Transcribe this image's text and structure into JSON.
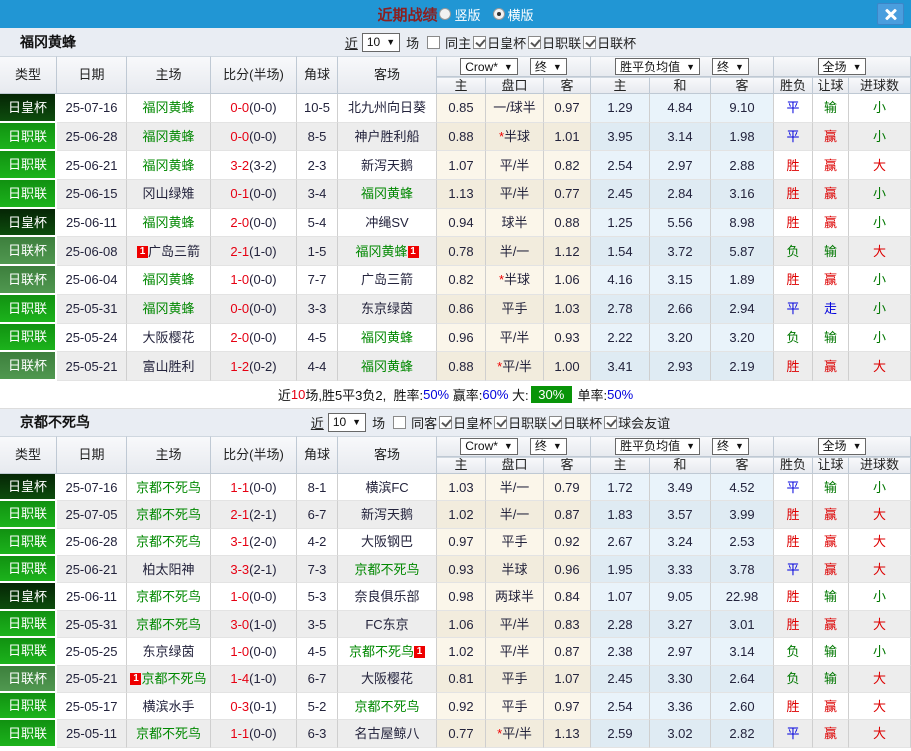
{
  "colors": {
    "topbar_bg": "#2196d4",
    "title_color": "#8b1f1f",
    "team_green": "#008800",
    "score_red": "#e60012",
    "res_red": "#dd0000",
    "res_blue": "#0000dd",
    "res_green": "#007700"
  },
  "topbar": {
    "title": "近期战绩",
    "radios": [
      {
        "label": "竖版",
        "checked": false
      },
      {
        "label": "横版",
        "checked": true
      }
    ]
  },
  "table_header": {
    "left_cols": [
      "类型",
      "日期",
      "主场",
      "比分(半场)",
      "角球",
      "客场"
    ],
    "groups": [
      {
        "selects": [
          "Crow*",
          "终"
        ],
        "cols": [
          "主",
          "盘口",
          "客"
        ]
      },
      {
        "selects": [
          "胜平负均值",
          "终"
        ],
        "cols": [
          "主",
          "和",
          "客"
        ]
      },
      {
        "selects": [
          "全场"
        ],
        "cols": [
          "胜负",
          "让球",
          "进球数"
        ]
      }
    ]
  },
  "sections": [
    {
      "team": "福冈黄蜂",
      "filter": {
        "near": "近",
        "count": "10",
        "games": "场",
        "same": {
          "label": "同主",
          "checked": false
        },
        "leagues": [
          {
            "label": "日皇杯",
            "checked": true
          },
          {
            "label": "日职联",
            "checked": true
          },
          {
            "label": "日联杯",
            "checked": true
          }
        ]
      },
      "rows": [
        {
          "type": "日皇杯",
          "style": "cup",
          "date": "25-07-16",
          "home": {
            "name": "福冈黄蜂",
            "green": true
          },
          "ft": "0-0",
          "ht": "(0-0)",
          "corner": "10-5",
          "away": {
            "name": "北九州向日葵"
          },
          "o1": "0.85",
          "pan": "一/球半",
          "pan_star": false,
          "o2": "0.97",
          "a1": "1.29",
          "a2": "4.84",
          "a3": "9.10",
          "res": "平",
          "res_c": "blue",
          "let": "输",
          "let_c": "green",
          "size": "小",
          "size_c": "green"
        },
        {
          "type": "日职联",
          "style": "jl",
          "date": "25-06-28",
          "home": {
            "name": "福冈黄蜂",
            "green": true
          },
          "ft": "0-0",
          "ht": "(0-0)",
          "corner": "8-5",
          "away": {
            "name": "神户胜利船"
          },
          "o1": "0.88",
          "pan": "半球",
          "pan_star": true,
          "o2": "1.01",
          "a1": "3.95",
          "a2": "3.14",
          "a3": "1.98",
          "res": "平",
          "res_c": "blue",
          "let": "赢",
          "let_c": "red",
          "size": "小",
          "size_c": "green"
        },
        {
          "type": "日职联",
          "style": "jl",
          "date": "25-06-21",
          "home": {
            "name": "福冈黄蜂",
            "green": true
          },
          "ft": "3-2",
          "ht": "(3-2)",
          "corner": "2-3",
          "away": {
            "name": "新泻天鹅"
          },
          "o1": "1.07",
          "pan": "平/半",
          "pan_star": false,
          "o2": "0.82",
          "a1": "2.54",
          "a2": "2.97",
          "a3": "2.88",
          "res": "胜",
          "res_c": "red",
          "let": "赢",
          "let_c": "red",
          "size": "大",
          "size_c": "red"
        },
        {
          "type": "日职联",
          "style": "jl",
          "date": "25-06-15",
          "home": {
            "name": "冈山绿雉"
          },
          "ft": "0-1",
          "ht": "(0-0)",
          "corner": "3-4",
          "away": {
            "name": "福冈黄蜂",
            "green": true
          },
          "o1": "1.13",
          "pan": "平/半",
          "pan_star": false,
          "o2": "0.77",
          "a1": "2.45",
          "a2": "2.84",
          "a3": "3.16",
          "res": "胜",
          "res_c": "red",
          "let": "赢",
          "let_c": "red",
          "size": "小",
          "size_c": "green"
        },
        {
          "type": "日皇杯",
          "style": "cup",
          "date": "25-06-11",
          "home": {
            "name": "福冈黄蜂",
            "green": true
          },
          "ft": "2-0",
          "ht": "(0-0)",
          "corner": "5-4",
          "away": {
            "name": "冲绳SV"
          },
          "o1": "0.94",
          "pan": "球半",
          "pan_star": false,
          "o2": "0.88",
          "a1": "1.25",
          "a2": "5.56",
          "a3": "8.98",
          "res": "胜",
          "res_c": "red",
          "let": "赢",
          "let_c": "red",
          "size": "小",
          "size_c": "green"
        },
        {
          "type": "日联杯",
          "style": "lc",
          "date": "25-06-08",
          "home": {
            "name": "广岛三箭",
            "badge_before": "1"
          },
          "ft": "2-1",
          "ht": "(1-0)",
          "corner": "1-5",
          "away": {
            "name": "福冈黄蜂",
            "green": true,
            "badge_after": "1"
          },
          "o1": "0.78",
          "pan": "半/一",
          "pan_star": false,
          "o2": "1.12",
          "a1": "1.54",
          "a2": "3.72",
          "a3": "5.87",
          "res": "负",
          "res_c": "green",
          "let": "输",
          "let_c": "green",
          "size": "大",
          "size_c": "red"
        },
        {
          "type": "日联杯",
          "style": "lc",
          "date": "25-06-04",
          "home": {
            "name": "福冈黄蜂",
            "green": true
          },
          "ft": "1-0",
          "ht": "(0-0)",
          "corner": "7-7",
          "away": {
            "name": "广岛三箭"
          },
          "o1": "0.82",
          "pan": "半球",
          "pan_star": true,
          "o2": "1.06",
          "a1": "4.16",
          "a2": "3.15",
          "a3": "1.89",
          "res": "胜",
          "res_c": "red",
          "let": "赢",
          "let_c": "red",
          "size": "小",
          "size_c": "green"
        },
        {
          "type": "日职联",
          "style": "jl",
          "date": "25-05-31",
          "home": {
            "name": "福冈黄蜂",
            "green": true
          },
          "ft": "0-0",
          "ht": "(0-0)",
          "corner": "3-3",
          "away": {
            "name": "东京绿茵"
          },
          "o1": "0.86",
          "pan": "平手",
          "pan_star": false,
          "o2": "1.03",
          "a1": "2.78",
          "a2": "2.66",
          "a3": "2.94",
          "res": "平",
          "res_c": "blue",
          "let": "走",
          "let_c": "blue",
          "size": "小",
          "size_c": "green"
        },
        {
          "type": "日职联",
          "style": "jl",
          "date": "25-05-24",
          "home": {
            "name": "大阪樱花"
          },
          "ft": "2-0",
          "ht": "(0-0)",
          "corner": "4-5",
          "away": {
            "name": "福冈黄蜂",
            "green": true
          },
          "o1": "0.96",
          "pan": "平/半",
          "pan_star": false,
          "o2": "0.93",
          "a1": "2.22",
          "a2": "3.20",
          "a3": "3.20",
          "res": "负",
          "res_c": "green",
          "let": "输",
          "let_c": "green",
          "size": "小",
          "size_c": "green"
        },
        {
          "type": "日联杯",
          "style": "lc",
          "date": "25-05-21",
          "home": {
            "name": "富山胜利"
          },
          "ft": "1-2",
          "ht": "(0-2)",
          "corner": "4-4",
          "away": {
            "name": "福冈黄蜂",
            "green": true
          },
          "o1": "0.88",
          "pan": "平/半",
          "pan_star": true,
          "o2": "1.00",
          "a1": "3.41",
          "a2": "2.93",
          "a3": "2.19",
          "res": "胜",
          "res_c": "red",
          "let": "赢",
          "let_c": "red",
          "size": "大",
          "size_c": "red"
        }
      ],
      "summary": {
        "prefix": "近",
        "count": "10",
        "mid": "场,胜5平3负2, ",
        "stats": [
          {
            "label": "胜率:",
            "value": "50%",
            "style": "blue"
          },
          {
            "label": "赢率:",
            "value": "60%",
            "style": "blue"
          },
          {
            "label": "大:",
            "value": "30%",
            "style": "badge"
          },
          {
            "label": "单率:",
            "value": "50%",
            "style": "blue"
          }
        ]
      }
    },
    {
      "team": "京都不死鸟",
      "filter": {
        "near": "近",
        "count": "10",
        "games": "场",
        "same": {
          "label": "同客",
          "checked": false
        },
        "leagues": [
          {
            "label": "日皇杯",
            "checked": true
          },
          {
            "label": "日职联",
            "checked": true
          },
          {
            "label": "日联杯",
            "checked": true
          },
          {
            "label": "球会友谊",
            "checked": true
          }
        ]
      },
      "rows": [
        {
          "type": "日皇杯",
          "style": "cup",
          "date": "25-07-16",
          "home": {
            "name": "京都不死鸟",
            "green": true
          },
          "ft": "1-1",
          "ht": "(0-0)",
          "corner": "8-1",
          "away": {
            "name": "横滨FC"
          },
          "o1": "1.03",
          "pan": "半/一",
          "pan_star": false,
          "o2": "0.79",
          "a1": "1.72",
          "a2": "3.49",
          "a3": "4.52",
          "res": "平",
          "res_c": "blue",
          "let": "输",
          "let_c": "green",
          "size": "小",
          "size_c": "green"
        },
        {
          "type": "日职联",
          "style": "jl",
          "date": "25-07-05",
          "home": {
            "name": "京都不死鸟",
            "green": true
          },
          "ft": "2-1",
          "ht": "(2-1)",
          "corner": "6-7",
          "away": {
            "name": "新泻天鹅"
          },
          "o1": "1.02",
          "pan": "半/一",
          "pan_star": false,
          "o2": "0.87",
          "a1": "1.83",
          "a2": "3.57",
          "a3": "3.99",
          "res": "胜",
          "res_c": "red",
          "let": "赢",
          "let_c": "red",
          "size": "大",
          "size_c": "red"
        },
        {
          "type": "日职联",
          "style": "jl",
          "date": "25-06-28",
          "home": {
            "name": "京都不死鸟",
            "green": true
          },
          "ft": "3-1",
          "ht": "(2-0)",
          "corner": "4-2",
          "away": {
            "name": "大阪钢巴"
          },
          "o1": "0.97",
          "pan": "平手",
          "pan_star": false,
          "o2": "0.92",
          "a1": "2.67",
          "a2": "3.24",
          "a3": "2.53",
          "res": "胜",
          "res_c": "red",
          "let": "赢",
          "let_c": "red",
          "size": "大",
          "size_c": "red"
        },
        {
          "type": "日职联",
          "style": "jl",
          "date": "25-06-21",
          "home": {
            "name": "柏太阳神"
          },
          "ft": "3-3",
          "ht": "(2-1)",
          "corner": "7-3",
          "away": {
            "name": "京都不死鸟",
            "green": true
          },
          "o1": "0.93",
          "pan": "半球",
          "pan_star": false,
          "o2": "0.96",
          "a1": "1.95",
          "a2": "3.33",
          "a3": "3.78",
          "res": "平",
          "res_c": "blue",
          "let": "赢",
          "let_c": "red",
          "size": "大",
          "size_c": "red"
        },
        {
          "type": "日皇杯",
          "style": "cup",
          "date": "25-06-11",
          "home": {
            "name": "京都不死鸟",
            "green": true
          },
          "ft": "1-0",
          "ht": "(0-0)",
          "corner": "5-3",
          "away": {
            "name": "奈良俱乐部"
          },
          "o1": "0.98",
          "pan": "两球半",
          "pan_star": false,
          "o2": "0.84",
          "a1": "1.07",
          "a2": "9.05",
          "a3": "22.98",
          "res": "胜",
          "res_c": "red",
          "let": "输",
          "let_c": "green",
          "size": "小",
          "size_c": "green"
        },
        {
          "type": "日职联",
          "style": "jl",
          "date": "25-05-31",
          "home": {
            "name": "京都不死鸟",
            "green": true
          },
          "ft": "3-0",
          "ht": "(1-0)",
          "corner": "3-5",
          "away": {
            "name": "FC东京"
          },
          "o1": "1.06",
          "pan": "平/半",
          "pan_star": false,
          "o2": "0.83",
          "a1": "2.28",
          "a2": "3.27",
          "a3": "3.01",
          "res": "胜",
          "res_c": "red",
          "let": "赢",
          "let_c": "red",
          "size": "大",
          "size_c": "red"
        },
        {
          "type": "日职联",
          "style": "jl",
          "date": "25-05-25",
          "home": {
            "name": "东京绿茵"
          },
          "ft": "1-0",
          "ht": "(0-0)",
          "corner": "4-5",
          "away": {
            "name": "京都不死鸟",
            "green": true,
            "badge_after": "1"
          },
          "o1": "1.02",
          "pan": "平/半",
          "pan_star": false,
          "o2": "0.87",
          "a1": "2.38",
          "a2": "2.97",
          "a3": "3.14",
          "res": "负",
          "res_c": "green",
          "let": "输",
          "let_c": "green",
          "size": "小",
          "size_c": "green"
        },
        {
          "type": "日联杯",
          "style": "lc",
          "date": "25-05-21",
          "home": {
            "name": "京都不死鸟",
            "green": true,
            "badge_before": "1"
          },
          "ft": "1-4",
          "ht": "(1-0)",
          "corner": "6-7",
          "away": {
            "name": "大阪樱花"
          },
          "o1": "0.81",
          "pan": "平手",
          "pan_star": false,
          "o2": "1.07",
          "a1": "2.45",
          "a2": "3.30",
          "a3": "2.64",
          "res": "负",
          "res_c": "green",
          "let": "输",
          "let_c": "green",
          "size": "大",
          "size_c": "red"
        },
        {
          "type": "日职联",
          "style": "jl",
          "date": "25-05-17",
          "home": {
            "name": "横滨水手"
          },
          "ft": "0-3",
          "ht": "(0-1)",
          "corner": "5-2",
          "away": {
            "name": "京都不死鸟",
            "green": true
          },
          "o1": "0.92",
          "pan": "平手",
          "pan_star": false,
          "o2": "0.97",
          "a1": "2.54",
          "a2": "3.36",
          "a3": "2.60",
          "res": "胜",
          "res_c": "red",
          "let": "赢",
          "let_c": "red",
          "size": "大",
          "size_c": "red"
        },
        {
          "type": "日职联",
          "style": "jl",
          "date": "25-05-11",
          "home": {
            "name": "京都不死鸟",
            "green": true
          },
          "ft": "1-1",
          "ht": "(0-0)",
          "corner": "6-3",
          "away": {
            "name": "名古屋鲸八"
          },
          "o1": "0.77",
          "pan": "平/半",
          "pan_star": true,
          "o2": "1.13",
          "a1": "2.59",
          "a2": "3.02",
          "a3": "2.82",
          "res": "平",
          "res_c": "blue",
          "let": "赢",
          "let_c": "red",
          "size": "大",
          "size_c": "red"
        }
      ]
    }
  ]
}
